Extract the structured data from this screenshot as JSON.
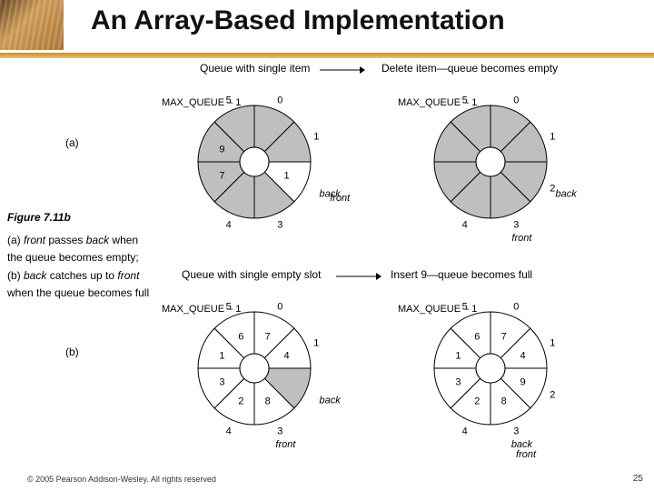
{
  "title": "An Array-Based Implementation",
  "figure": {
    "number": "Figure 7.11b",
    "line1_a": "(a) ",
    "line1_b": "front",
    "line1_c": " passes ",
    "line1_d": "back",
    "line1_e": " when",
    "line2": "the queue becomes empty;",
    "line3_a": "(b) ",
    "line3_b": "back ",
    "line3_c": " catches up to ",
    "line3_d": "front",
    "line4": "when the queue becomes full"
  },
  "labels": {
    "a": "(a)",
    "b": "(b)",
    "top_left": "Queue with single item",
    "top_right": "Delete item—queue becomes empty",
    "bot_left": "Queue with single empty slot",
    "bot_right": "Insert 9—queue becomes full",
    "max_queue": "MAX_QUEUE – 1",
    "front": "front",
    "back": "back"
  },
  "wheels": {
    "a_left": {
      "slots": [
        "0",
        "1",
        "",
        "3",
        "4",
        "",
        "",
        "5"
      ],
      "fill": [
        1,
        1,
        0,
        1,
        1,
        1,
        1,
        1
      ],
      "vals": [
        "",
        "",
        "1",
        "",
        "",
        "7",
        "9",
        ""
      ],
      "front_at": 2,
      "back_at": 2,
      "front_label_pos": "bottom",
      "back_label_pos": "bottom-left"
    },
    "a_right": {
      "slots": [
        "0",
        "1",
        "2",
        "3",
        "4",
        "",
        "",
        "5"
      ],
      "fill": [
        1,
        1,
        1,
        1,
        1,
        1,
        1,
        1
      ],
      "vals": [
        "",
        "",
        "",
        "",
        "",
        "",
        "",
        ""
      ],
      "front_at": 3,
      "back_at": 2,
      "front_label_pos": "right",
      "back_label_pos": "bottom"
    },
    "b_left": {
      "slots": [
        "0",
        "1",
        "",
        "3",
        "4",
        "",
        "",
        "5"
      ],
      "fill": [
        0,
        0,
        1,
        0,
        0,
        0,
        0,
        0
      ],
      "vals": [
        "7",
        "4",
        "",
        "8",
        "2",
        "3",
        "1",
        "6"
      ],
      "front_at": 3,
      "back_at": 2,
      "front_label_pos": "left",
      "back_label_pos": "bottom"
    },
    "b_right": {
      "slots": [
        "0",
        "1",
        "2",
        "3",
        "4",
        "",
        "",
        "5"
      ],
      "fill": [
        0,
        0,
        0,
        0,
        0,
        0,
        0,
        0
      ],
      "vals": [
        "7",
        "4",
        "9",
        "8",
        "2",
        "3",
        "1",
        "6"
      ],
      "front_at": 3,
      "back_at": 3,
      "front_label_pos": "left",
      "back_label_pos": "bottom"
    }
  },
  "footer": "© 2005 Pearson Addison-Wesley. All rights reserved",
  "page": "25"
}
